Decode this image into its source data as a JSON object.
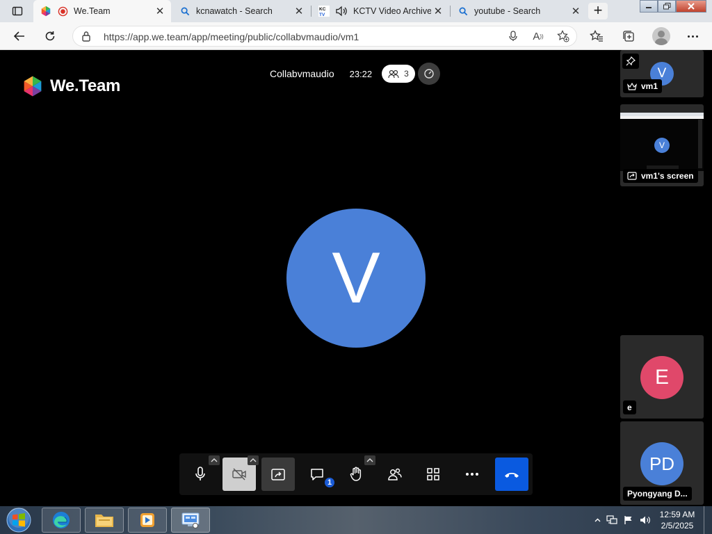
{
  "browser": {
    "tabs": [
      {
        "title": "We.Team",
        "icon": "weteam-logo-icon",
        "active": true
      },
      {
        "title": "kcnawatch - Search",
        "icon": "search-icon"
      },
      {
        "title": "KCTV Video Archive",
        "icon": "kctv-icon"
      },
      {
        "title": "youtube - Search",
        "icon": "search-icon"
      }
    ],
    "close_glyph": "✕",
    "url": "https://app.we.team/app/meeting/public/collabvmaudio/vm1"
  },
  "meeting": {
    "logo_text": "We.Team",
    "name": "Collabvmaudio",
    "timer": "23:22",
    "participant_count": "3",
    "main_avatar_letter": "V",
    "colors": {
      "avatar_blue": "#4a80d8",
      "avatar_red": "#e0486a",
      "hangup": "#0a5ae0"
    },
    "filmstrip": [
      {
        "label": "vm1",
        "initials": "V"
      },
      {
        "label": "vm1's screen",
        "initials": "V"
      },
      {
        "label": "e",
        "initials": "E"
      },
      {
        "label": "Pyongyang D...",
        "initials": "PD"
      }
    ],
    "toolbar": {
      "chat_badge": "1"
    }
  },
  "taskbar": {
    "time": "12:59 AM",
    "date": "2/5/2025"
  }
}
